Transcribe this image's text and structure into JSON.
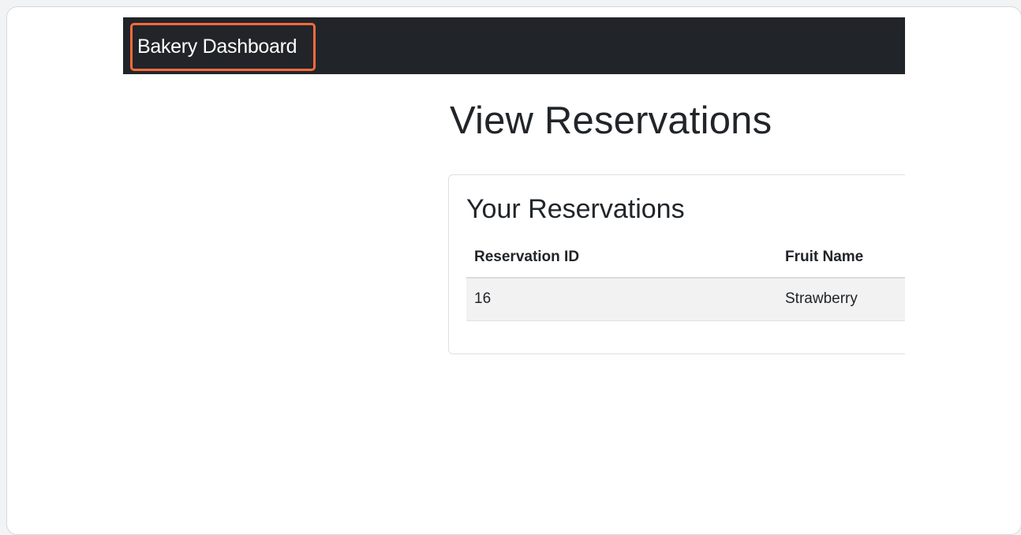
{
  "navbar": {
    "brand": "Bakery Dashboard"
  },
  "page": {
    "title": "View Reservations"
  },
  "card": {
    "title": "Your Reservations",
    "table": {
      "headers": [
        "Reservation ID",
        "Fruit Name"
      ],
      "rows": [
        [
          "16",
          "Strawberry"
        ]
      ]
    }
  },
  "colors": {
    "navbar_bg": "#212529",
    "highlight": "#ff6a3d",
    "row_stripe": "#f2f2f2"
  }
}
